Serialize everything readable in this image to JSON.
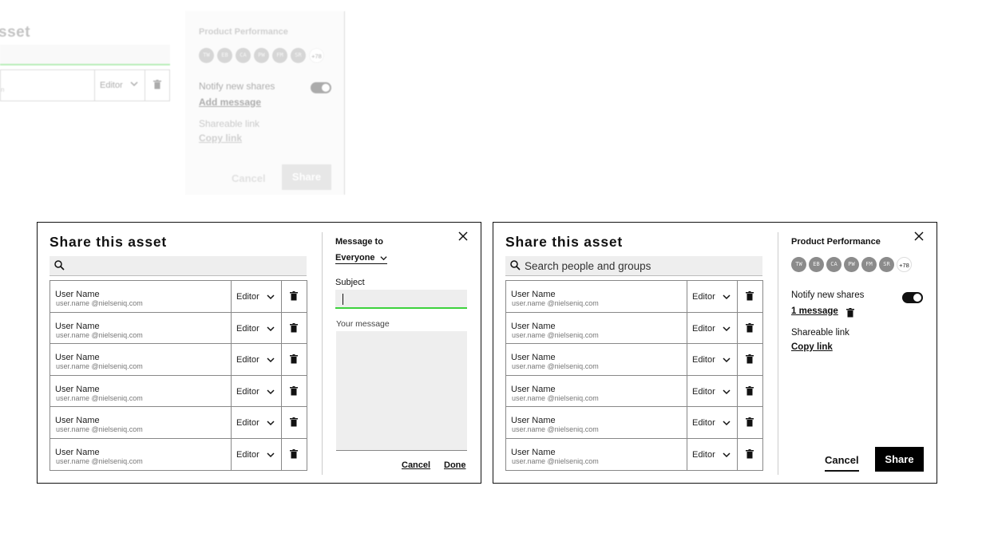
{
  "background_faded": {
    "title": "sset",
    "role": "Editor",
    "email_fragment": "n",
    "panel_title": "Product Performance",
    "avatars": [
      "TW",
      "EB",
      "CA",
      "PW",
      "FM",
      "SR"
    ],
    "avatars_more": "+78",
    "notify_label": "Notify new shares",
    "add_message": "Add message",
    "shareable_label": "Shareable link",
    "copy_link": "Copy link",
    "cancel": "Cancel",
    "share": "Share"
  },
  "message_dialog": {
    "title": "Share this asset",
    "search_value": "",
    "message_to_label": "Message to",
    "message_to_value": "Everyone",
    "subject_label": "Subject",
    "subject_value": "",
    "message_label": "Your message",
    "cancel": "Cancel",
    "done": "Done",
    "users": [
      {
        "name": "User Name",
        "email": "user.name @nielseniq.com",
        "role": "Editor"
      },
      {
        "name": "User Name",
        "email": "user.name @nielseniq.com",
        "role": "Editor"
      },
      {
        "name": "User Name",
        "email": "user.name @nielseniq.com",
        "role": "Editor"
      },
      {
        "name": "User Name",
        "email": "user.name @nielseniq.com",
        "role": "Editor"
      },
      {
        "name": "User Name",
        "email": "user.name @nielseniq.com",
        "role": "Editor"
      },
      {
        "name": "User Name",
        "email": "user.name @nielseniq.com",
        "role": "Editor"
      }
    ]
  },
  "share_dialog": {
    "title": "Share this asset",
    "search_placeholder": "Search people and groups",
    "panel_title": "Product Performance",
    "avatars": [
      "TW",
      "EB",
      "CA",
      "PW",
      "FM",
      "SR"
    ],
    "avatars_more": "+78",
    "notify_label": "Notify new shares",
    "notify_on": true,
    "message_count": "1 message",
    "shareable_label": "Shareable link",
    "copy_link": "Copy link",
    "cancel": "Cancel",
    "share": "Share",
    "users": [
      {
        "name": "User Name",
        "email": "user.name @nielseniq.com",
        "role": "Editor"
      },
      {
        "name": "User Name",
        "email": "user.name @nielseniq.com",
        "role": "Editor"
      },
      {
        "name": "User Name",
        "email": "user.name @nielseniq.com",
        "role": "Editor"
      },
      {
        "name": "User Name",
        "email": "user.name @nielseniq.com",
        "role": "Editor"
      },
      {
        "name": "User Name",
        "email": "user.name @nielseniq.com",
        "role": "Editor"
      },
      {
        "name": "User Name",
        "email": "user.name @nielseniq.com",
        "role": "Editor"
      }
    ]
  },
  "colors": {
    "accent_green": "#3dd23d",
    "primary_button": "#000000",
    "avatar_gray": "#8b8b8b",
    "field_bg": "#eeeeee"
  },
  "icons": {
    "search": "search-icon",
    "close": "close-icon",
    "chevron": "chevron-down-icon",
    "trash": "trash-icon",
    "toggle": "toggle-icon"
  }
}
